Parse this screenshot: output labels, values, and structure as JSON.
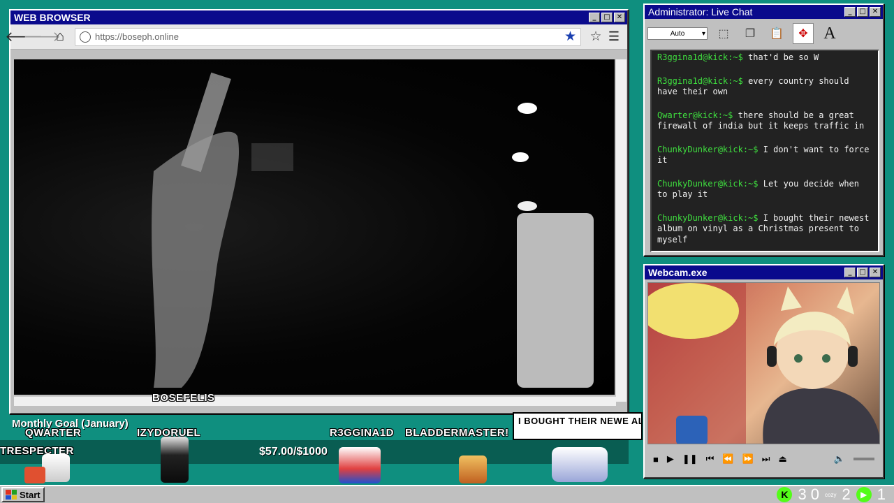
{
  "browser": {
    "title": "WEB BROWSER",
    "url": "https://boseph.online"
  },
  "chat": {
    "title": "Administrator: Live Chat",
    "select_value": "Auto",
    "messages": [
      {
        "user": "R3ggina1d@kick:~$",
        "text": "that'd be so W"
      },
      {
        "user": "R3ggina1d@kick:~$",
        "text": "every country should have their own"
      },
      {
        "user": "Qwarter@kick:~$",
        "text": "there should be a great firewall of india but it keeps traffic in"
      },
      {
        "user": "ChunkyDunker@kick:~$",
        "text": "I don't want to force it"
      },
      {
        "user": "ChunkyDunker@kick:~$",
        "text": "Let you decide when to play it"
      },
      {
        "user": "ChunkyDunker@kick:~$",
        "text": "I bought their newest album on vinyl as a Christmas present to myself"
      }
    ]
  },
  "webcam": {
    "title": "Webcam.exe"
  },
  "overlay": {
    "goal_title": "Monthly Goal (January)",
    "goal_amount": "$57.00/$1000",
    "names": {
      "bosefelis": "BOSEFELIS",
      "qwarter": "QWARTER",
      "izydoruel": "IZYDORUEL",
      "r3gginaid": "R3GGINA1D",
      "bladdermaster": "BLADDERMASTER!",
      "trespecter": "TRESPECTER"
    },
    "bubble_text": "I BOUGHT THEIR NEWE ALBUM ON VINYL AS"
  },
  "taskbar": {
    "start_label": "Start",
    "count_a": "3 0",
    "cozy": "cozy",
    "count_b": "2",
    "count_c": "1"
  },
  "colors": {
    "desktop": "#0f8f7f",
    "titlebar": "#0a0a8c",
    "chat_user": "#3fe03f",
    "kick_green": "#53fc18"
  }
}
